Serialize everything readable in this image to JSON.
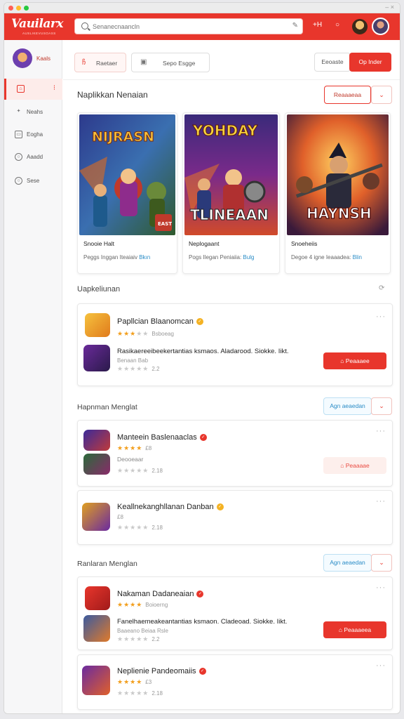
{
  "window": {
    "controls": "– ×"
  },
  "header": {
    "logo": "Vauilarx",
    "logo_sub": "AUSLIKEVUSOASS",
    "search_placeholder": "Senanecnaancln",
    "icons": [
      "notification-icon",
      "clock-icon"
    ],
    "icon_labels": [
      "+H",
      "○"
    ]
  },
  "sidebar": {
    "user_label": "Kaals",
    "items": [
      {
        "label": "",
        "icon": "home-icon",
        "glyph": "⌂",
        "badge": "⁝"
      },
      {
        "label": "Neahs",
        "icon": "games-icon",
        "glyph": "✦"
      },
      {
        "label": "Eogha",
        "icon": "library-icon",
        "glyph": "▭"
      },
      {
        "label": "Aaadd",
        "icon": "settings-icon",
        "glyph": "○"
      },
      {
        "label": "Sese",
        "icon": "info-icon",
        "glyph": "○"
      }
    ]
  },
  "toolbar": {
    "tab1": "Raetaer",
    "tab1_icon": "ჩ",
    "tab2": "Sepo Esgge",
    "tab2_icon": "▣",
    "btn_secondary": "Eeoaste",
    "btn_primary": "Op Inder"
  },
  "featured": {
    "title": "Naplikkan Nenaian",
    "action": "Reaaaeaa",
    "cards": [
      {
        "title_art": [
          "NIJRASN",
          "EAST"
        ],
        "name": "Snooie Halt",
        "desc": "Peggs Inggan Iteaiaiv",
        "link": "Bkın"
      },
      {
        "title_art": [
          "YOHDAY",
          "TLINEAAN"
        ],
        "name": "Neplogaant",
        "desc": "Pogs Ilegan Peniaiia:",
        "link": "Bulg"
      },
      {
        "title_art": [
          "",
          "HAYNSH"
        ],
        "name": "Snoeheiis",
        "desc": "Degoe 4 igne Ieaaadea:",
        "link": "Blin"
      }
    ]
  },
  "section1": {
    "title": "Uapkeliunan",
    "app": {
      "name": "Papllcian Blaanomcan",
      "rating_text": "Bsboeag",
      "stars": 3,
      "desc": "Rasikaereeibeekertantias ksmaos. Aladarood. Siokke. Iikt.",
      "desc2": "Benaan Bab",
      "stars2": 0,
      "count2": "2.2",
      "button": "Peaaaee"
    }
  },
  "section2": {
    "title": "Hapnman Menglat",
    "action": "Agn aeaedan",
    "apps": [
      {
        "name": "Manteein Baslenaaclas",
        "stars": 4,
        "count": "£8",
        "sub": "Deooeaar",
        "count2": "2.18",
        "button": "Peaaaae"
      },
      {
        "name": "Keallnekanghllanan Danban",
        "stars": 0,
        "count": "£8",
        "count2": "2.18"
      }
    ]
  },
  "section3": {
    "title": "Ranlaran Menglan",
    "action": "Agn aeaedan",
    "apps": [
      {
        "name": "Nakaman Dadaneaian",
        "stars": 4,
        "rating_text": "Boioerng",
        "desc": "Fanelhaemeakeantantias ksmaon. Cladeoad. Siokke. Iikt.",
        "desc2": "Baaeano Beiaa Rsle",
        "count2": "2.2",
        "button": "Peaaaeea"
      },
      {
        "name": "Neplienie Pandeomaiis",
        "stars": 4,
        "count": "£3",
        "count2": "2.18"
      }
    ]
  },
  "colors": {
    "accent": "#e8362c",
    "link": "#2a8cc6",
    "star": "#f29e1c"
  }
}
